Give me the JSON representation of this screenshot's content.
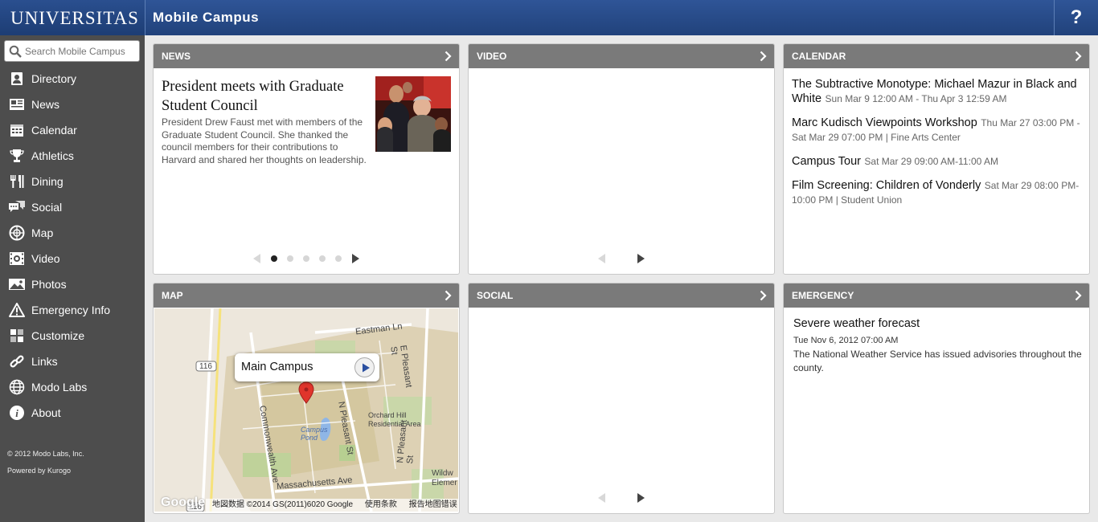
{
  "header": {
    "logo": "UNIVERSITAS",
    "title": "Mobile Campus",
    "help_label": "?"
  },
  "search": {
    "placeholder": "Search Mobile Campus"
  },
  "sidebar": {
    "items": [
      {
        "label": "Directory",
        "icon": "directory-icon"
      },
      {
        "label": "News",
        "icon": "news-icon"
      },
      {
        "label": "Calendar",
        "icon": "calendar-icon"
      },
      {
        "label": "Athletics",
        "icon": "trophy-icon"
      },
      {
        "label": "Dining",
        "icon": "dining-icon"
      },
      {
        "label": "Social",
        "icon": "social-icon"
      },
      {
        "label": "Map",
        "icon": "map-icon"
      },
      {
        "label": "Video",
        "icon": "video-icon"
      },
      {
        "label": "Photos",
        "icon": "photos-icon"
      },
      {
        "label": "Emergency Info",
        "icon": "warning-icon"
      },
      {
        "label": "Customize",
        "icon": "customize-icon"
      },
      {
        "label": "Links",
        "icon": "link-icon"
      },
      {
        "label": "Modo Labs",
        "icon": "globe-icon"
      },
      {
        "label": "About",
        "icon": "info-icon"
      }
    ],
    "copyright": "© 2012 Modo Labs, Inc.",
    "powered": "Powered by Kurogo"
  },
  "panels": {
    "news": {
      "title": "NEWS",
      "headline": "President meets with Graduate Student Council",
      "body": "President Drew Faust met with members of the Graduate Student Council. She thanked the council members for their contributions to Harvard and shared her thoughts on leadership."
    },
    "video": {
      "title": "VIDEO"
    },
    "calendar": {
      "title": "CALENDAR",
      "events": [
        {
          "title": "The Subtractive Monotype: Michael Mazur in Black and White",
          "detail": "Sun Mar 9 12:00 AM - Thu Apr 3 12:59 AM"
        },
        {
          "title": "Marc Kudisch Viewpoints Workshop",
          "detail": "Thu Mar 27 03:00 PM - Sat Mar 29 07:00 PM | Fine Arts Center"
        },
        {
          "title": "Campus Tour",
          "detail": "Sat Mar 29 09:00 AM-11:00 AM"
        },
        {
          "title": "Film Screening: Children of Vonderly",
          "detail": "Sat Mar 29 08:00 PM-10:00 PM | Student Union"
        }
      ]
    },
    "map": {
      "title": "MAP",
      "callout": "Main Campus",
      "labels": {
        "eastman": "Eastman Ln",
        "epleasant": "E Pleasant St",
        "npleasant": "N Pleasant St",
        "commonwealth": "Commonwealth Ave",
        "mass": "Massachusetts Ave",
        "orchard": "Orchard Hill Residential Area",
        "pond": "Campus Pond",
        "npleasant2": "N Pleasant St",
        "wildw": "Wildw Elemer",
        "route": "116",
        "route2": "116"
      },
      "attribution": [
        "地図数据 ©2014 GS(2011)6020 Google",
        "使用条款",
        "报告地图错误"
      ],
      "google": "Google"
    },
    "social": {
      "title": "SOCIAL"
    },
    "emergency": {
      "title": "EMERGENCY",
      "headline": "Severe weather forecast",
      "date": "Tue Nov 6, 2012 07:00 AM",
      "body": "The National Weather Service has issued advisories throughout the county."
    }
  }
}
